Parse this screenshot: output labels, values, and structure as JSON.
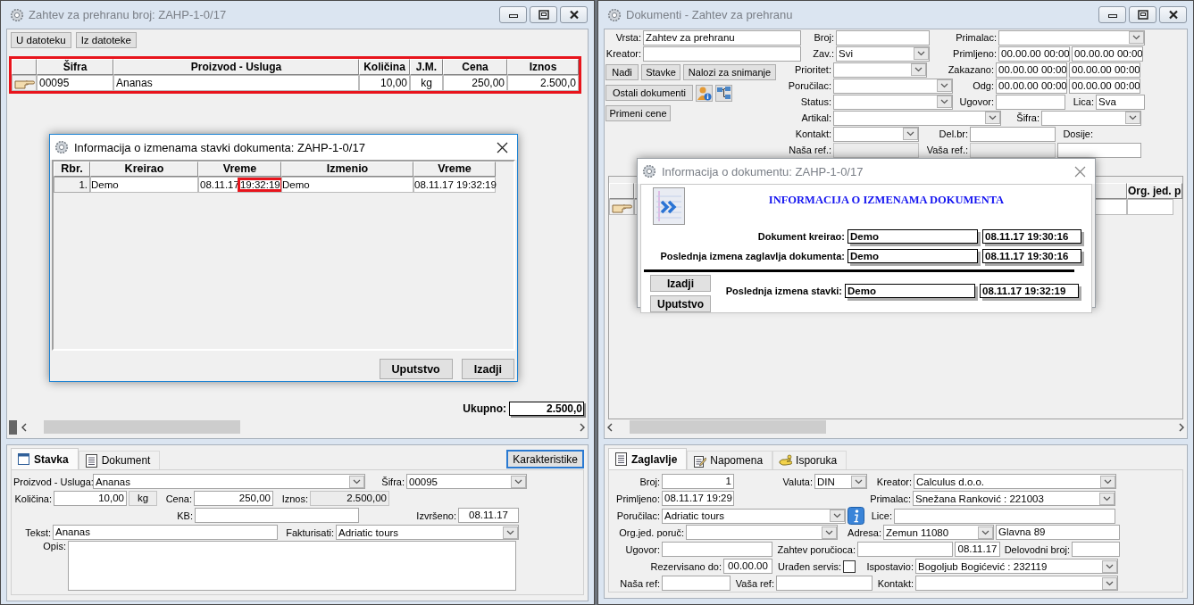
{
  "left_window": {
    "title": "Zahtev za prehranu broj: ZAHP-1-0/17",
    "active": false,
    "toolbar": [
      "U datoteku",
      "Iz datoteke"
    ],
    "items_table": {
      "highlighted": true,
      "columns": [
        "Šifra",
        "Proizvod - Usluga",
        "Količina",
        "J.M.",
        "Cena",
        "Iznos"
      ],
      "rows": [
        [
          "00095",
          "Ananas",
          "10,00",
          "kg",
          "250,00",
          "2.500,0"
        ]
      ]
    },
    "total": {
      "label": "Ukupno:",
      "value": "2.500,0"
    },
    "tabs": [
      {
        "label": "Stavka",
        "selected": true
      },
      {
        "label": "Dokument",
        "selected": false
      }
    ],
    "action_button": "Karakteristike",
    "form": [
      [
        {
          "kind": "label",
          "text": "Proizvod - Usluga:"
        },
        {
          "kind": "combo",
          "value": "Ananas"
        },
        {
          "kind": "label",
          "text": "Šifra:"
        },
        {
          "kind": "combo",
          "value": "00095"
        }
      ],
      [
        {
          "kind": "label",
          "text": "Količina:"
        },
        {
          "kind": "text",
          "value": "10,00"
        },
        {
          "kind": "readonly",
          "value": "kg"
        },
        {
          "kind": "label",
          "text": "Cena:"
        },
        {
          "kind": "text",
          "value": "250,00"
        },
        {
          "kind": "label",
          "text": "Iznos:"
        },
        {
          "kind": "readonly",
          "value": "2.500,00"
        }
      ],
      [
        {
          "kind": "label",
          "text": "KB:"
        },
        {
          "kind": "text"
        },
        {
          "kind": "label",
          "text": "Izvršeno:"
        },
        {
          "kind": "text",
          "value": "08.11.17"
        }
      ],
      [
        {
          "kind": "label",
          "text": "Tekst:"
        },
        {
          "kind": "text",
          "value": "Ananas"
        },
        {
          "kind": "label",
          "text": "Fakturisati:"
        },
        {
          "kind": "combo",
          "value": "Adriatic tours"
        }
      ],
      [
        {
          "kind": "label",
          "text": "Opis:"
        },
        {
          "kind": "area"
        }
      ]
    ]
  },
  "items_dialog": {
    "title": "Informacija o izmenama stavki dokumenta: ZAHP-1-0/17",
    "active": true,
    "columns": [
      "Rbr.",
      "Kreirao",
      "Vreme",
      "Izmenio",
      "Vreme"
    ],
    "rows": [
      {
        "rbr": "1.",
        "kreirao": "Demo",
        "vreme_date": "08.11.17",
        "vreme_time": "19:32:19",
        "time_highlighted": true,
        "izmenio": "Demo",
        "vreme": "08.11.17 19:32:19"
      }
    ],
    "buttons": [
      "Uputstvo",
      "Izadji"
    ]
  },
  "right_window": {
    "title": "Dokumenti - Zahtev za prehranu",
    "active": false,
    "filter_top": [
      [
        {
          "kind": "label",
          "text": "Vrsta:"
        },
        {
          "kind": "text",
          "value": "Zahtev za prehranu"
        },
        {
          "kind": "label",
          "text": "Broj:"
        },
        {
          "kind": "text"
        },
        {
          "kind": "label",
          "text": "Primalac:"
        },
        {
          "kind": "combo"
        }
      ],
      [
        {
          "kind": "label",
          "text": "Kreator:"
        },
        {
          "kind": "text"
        },
        {
          "kind": "label",
          "text": "Zav.:"
        },
        {
          "kind": "combo",
          "value": "Svi"
        },
        {
          "kind": "label",
          "text": "Primljeno:"
        },
        {
          "kind": "text",
          "value": "00.00.00 00:00"
        },
        {
          "kind": "text",
          "value": "00.00.00 00:00"
        }
      ]
    ],
    "filter_buttons": [
      [
        {
          "kind": "button",
          "text": "Nađi"
        },
        {
          "kind": "button",
          "text": "Stavke"
        },
        {
          "kind": "button",
          "text": "Nalozi za snimanje"
        }
      ],
      [
        {
          "kind": "button",
          "text": "Ostali dokumenti"
        },
        {
          "kind": "iconbutton"
        },
        {
          "kind": "iconbutton"
        }
      ],
      [
        {
          "kind": "button",
          "text": "Primeni cene"
        }
      ]
    ],
    "filter_rows": [
      [
        {
          "kind": "label",
          "text": "Prioritet:"
        },
        {
          "kind": "combo"
        },
        {
          "kind": "label",
          "text": "Zakazano:"
        },
        {
          "kind": "text",
          "value": "00.00.00 00:00"
        },
        {
          "kind": "text",
          "value": "00.00.00 00:00"
        }
      ],
      [
        {
          "kind": "label",
          "text": "Poručilac:"
        },
        {
          "kind": "combo"
        },
        {
          "kind": "label",
          "text": "Odg:"
        },
        {
          "kind": "text",
          "value": "00.00.00 00:00"
        },
        {
          "kind": "text",
          "value": "00.00.00 00:00"
        }
      ],
      [
        {
          "kind": "label",
          "text": "Status:"
        },
        {
          "kind": "combo"
        },
        {
          "kind": "label",
          "text": "Ugovor:"
        },
        {
          "kind": "text"
        },
        {
          "kind": "label",
          "text": "Lica:"
        },
        {
          "kind": "text",
          "value": "Sva"
        }
      ],
      [
        {
          "kind": "label",
          "text": "Artikal:"
        },
        {
          "kind": "combo"
        },
        {
          "kind": "label",
          "text": "Šifra:"
        },
        {
          "kind": "combo"
        }
      ],
      [
        {
          "kind": "label",
          "text": "Kontakt:"
        },
        {
          "kind": "combo"
        },
        {
          "kind": "label",
          "text": "Del.br:"
        },
        {
          "kind": "text"
        },
        {
          "kind": "label",
          "text": "Dosije:"
        }
      ],
      [
        {
          "kind": "label",
          "text": "Naša ref.:"
        },
        {
          "kind": "readonly"
        },
        {
          "kind": "label",
          "text": "Vaša ref.:"
        },
        {
          "kind": "readonly"
        },
        {
          "kind": "text"
        }
      ]
    ],
    "table": {
      "columns": [
        "Org. jed. p"
      ]
    },
    "tabs": [
      {
        "label": "Zaglavlje",
        "selected": true
      },
      {
        "label": "Napomena",
        "selected": false
      },
      {
        "label": "Isporuka",
        "selected": false
      }
    ],
    "form": [
      [
        {
          "kind": "label",
          "text": "Broj:"
        },
        {
          "kind": "text",
          "value": "1"
        },
        {
          "kind": "label",
          "text": "Valuta:"
        },
        {
          "kind": "combo",
          "value": "DIN"
        },
        {
          "kind": "label",
          "text": "Kreator:"
        },
        {
          "kind": "combo",
          "value": "Calculus d.o.o."
        }
      ],
      [
        {
          "kind": "label",
          "text": "Primljeno:"
        },
        {
          "kind": "text",
          "value": "08.11.17 19:29"
        },
        {
          "kind": "label",
          "text": "Primalac:"
        },
        {
          "kind": "combo",
          "value": "Snežana Ranković : 221003"
        }
      ],
      [
        {
          "kind": "label",
          "text": "Poručilac:"
        },
        {
          "kind": "combo",
          "value": "Adriatic tours"
        },
        {
          "kind": "infobutton"
        },
        {
          "kind": "label",
          "text": "Lice:"
        },
        {
          "kind": "text"
        }
      ],
      [
        {
          "kind": "label",
          "text": "Org.jed. poruč:"
        },
        {
          "kind": "combo"
        },
        {
          "kind": "label",
          "text": "Adresa:"
        },
        {
          "kind": "combo",
          "value": "Zemun  11080"
        },
        {
          "kind": "text",
          "value": "Glavna 89"
        }
      ],
      [
        {
          "kind": "label",
          "text": "Ugovor:"
        },
        {
          "kind": "text"
        },
        {
          "kind": "label",
          "text": "Zahtev poručioca:"
        },
        {
          "kind": "text"
        },
        {
          "kind": "text",
          "value": "08.11.17"
        },
        {
          "kind": "label",
          "text": "Delovodni broj:"
        },
        {
          "kind": "text"
        }
      ],
      [
        {
          "kind": "label",
          "text": "Rezervisano do:"
        },
        {
          "kind": "text",
          "value": "00.00.00"
        },
        {
          "kind": "label",
          "text": "Urađen servis:"
        },
        {
          "kind": "check",
          "checked": false
        },
        {
          "kind": "label",
          "text": "Ispostavio:"
        },
        {
          "kind": "combo",
          "value": "Bogoljub Bogićević : 232119"
        }
      ],
      [
        {
          "kind": "label",
          "text": "Naša ref:"
        },
        {
          "kind": "text"
        },
        {
          "kind": "label",
          "text": "Vaša ref:"
        },
        {
          "kind": "text"
        },
        {
          "kind": "label",
          "text": "Kontakt:"
        },
        {
          "kind": "combo"
        }
      ]
    ]
  },
  "document_dialog": {
    "title": "Informacija o dokumentu: ZAHP-1-0/17",
    "active": false,
    "heading": "INFORMACIJA O IZMENAMA DOKUMENTA",
    "entries": [
      {
        "label": "Dokument kreirao:",
        "user": "Demo",
        "time": "08.11.17 19:30:16"
      },
      {
        "label": "Poslednja izmena zaglavlja dokumenta:",
        "user": "Demo",
        "time": "08.11.17 19:30:16"
      },
      {
        "label": "Poslednja izmena stavki:",
        "user": "Demo",
        "time": "08.11.17 19:32:19"
      }
    ],
    "buttons": [
      "Izadji",
      "Uputstvo"
    ]
  }
}
